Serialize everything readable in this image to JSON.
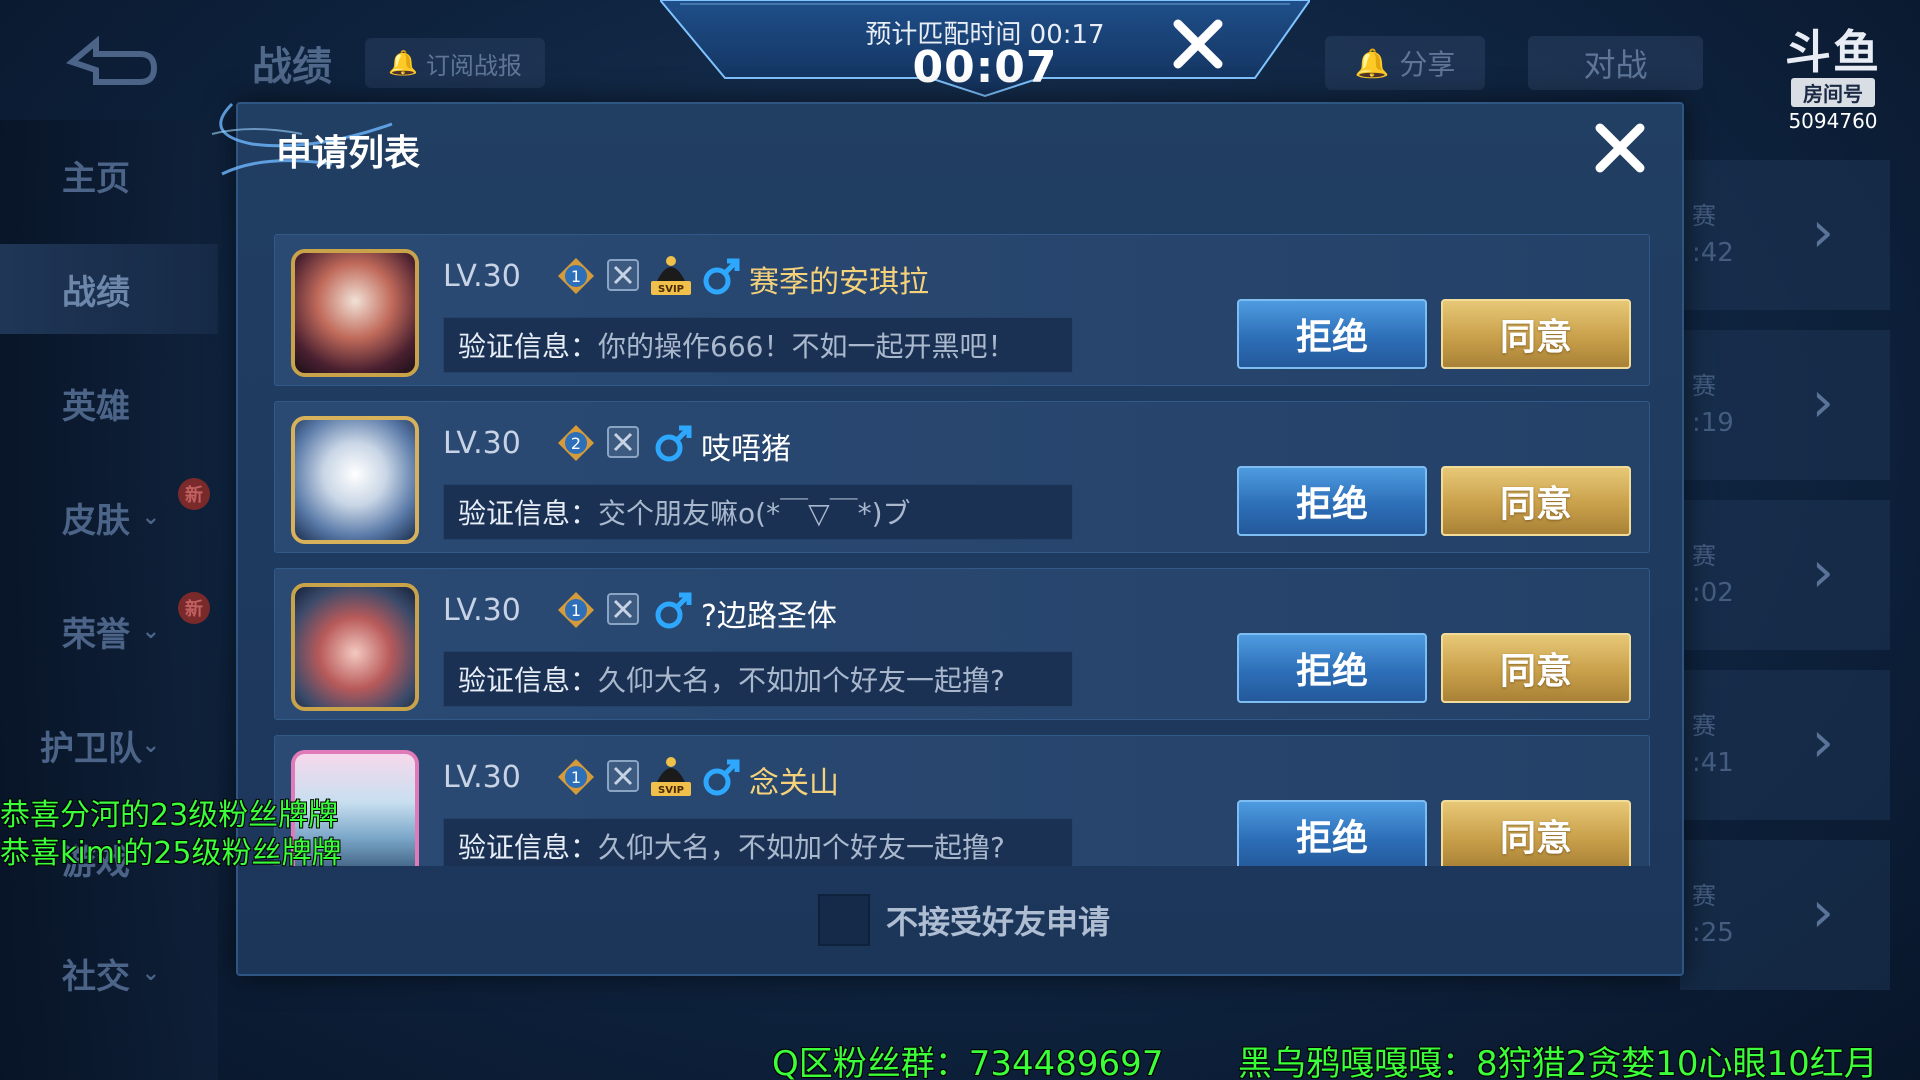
{
  "background": {
    "page_title": "战绩",
    "subscribe_label": "订阅战报",
    "share_label": "分享",
    "battle_label": "对战",
    "sidebar": [
      {
        "label": "主页"
      },
      {
        "label": "战绩"
      },
      {
        "label": "英雄"
      },
      {
        "label": "皮肤",
        "badge": "新"
      },
      {
        "label": "荣誉",
        "badge": "新"
      },
      {
        "label": "护卫队"
      },
      {
        "label": "游戏"
      },
      {
        "label": "社交"
      }
    ],
    "right_rows": [
      {
        "t1": "赛",
        "t2": ":42"
      },
      {
        "t1": "赛",
        "t2": ":19"
      },
      {
        "t1": "赛",
        "t2": ":02"
      },
      {
        "t1": "赛",
        "t2": ":41"
      },
      {
        "t1": "赛",
        "t2": ":25"
      }
    ]
  },
  "watermark": {
    "logo": "斗鱼",
    "room_label": "房间号",
    "room_number": "5094760"
  },
  "match_timer": {
    "label": "预计匹配时间 00:17",
    "elapsed": "00:07"
  },
  "modal": {
    "title": "申请列表",
    "verify_prefix": "验证信息：",
    "reject_label": "拒绝",
    "accept_label": "同意",
    "requests": [
      {
        "level": "LV.30",
        "rank": "1",
        "svip": true,
        "name": "赛季的安琪拉",
        "name_color": "#f5d27a",
        "message": "你的操作666！不如一起开黑吧！"
      },
      {
        "level": "LV.30",
        "rank": "2",
        "svip": false,
        "name": "吱唔猪",
        "name_color": "#ffffff",
        "message": "交个朋友嘛o(*￣▽￣*)ブ"
      },
      {
        "level": "LV.30",
        "rank": "1",
        "svip": false,
        "name": "?边路圣体",
        "name_color": "#ffffff",
        "message": "久仰大名，不如加个好友一起撸?"
      },
      {
        "level": "LV.30",
        "rank": "1",
        "svip": true,
        "name": "念关山",
        "name_color": "#f5d27a",
        "message": "久仰大名，不如加个好友一起撸?"
      }
    ],
    "reject_friend_label": "不接受好友申请"
  },
  "stream_overlay": {
    "left_messages": [
      "恭喜分河的23级粉丝牌牌",
      "恭喜kimi的25级粉丝牌牌"
    ],
    "fan_group": "Q区粉丝群：734489697",
    "ticker": "黑乌鸦嘎嘎嘎：8狩猎2贪婪10心眼10红月"
  },
  "svip_text": "SVIP",
  "colors": {
    "accent_gold": "#c9a04b",
    "accent_blue": "#2d6fb8",
    "overlay_green": "#3aff3a"
  }
}
